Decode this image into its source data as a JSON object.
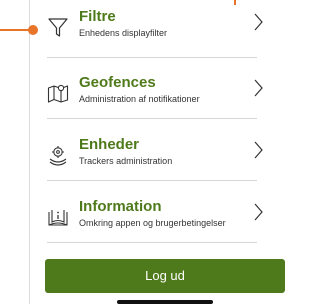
{
  "menu": {
    "items": [
      {
        "id": "filtre",
        "icon": "filter-icon",
        "title": "Filtre",
        "subtitle": "Enhedens displayfilter"
      },
      {
        "id": "geofences",
        "icon": "map-icon",
        "title": "Geofences",
        "subtitle": "Administration af notifikationer"
      },
      {
        "id": "enheder",
        "icon": "tracker-device-icon",
        "title": "Enheder",
        "subtitle": "Trackers administration"
      },
      {
        "id": "information",
        "icon": "info-book-icon",
        "title": "Information",
        "subtitle": "Omkring appen og brugerbetingelser"
      }
    ]
  },
  "logout": {
    "label": "Log ud"
  },
  "colors": {
    "accent": "#e8742a",
    "brand": "#4f7a1b",
    "text": "#333333",
    "divider": "#d6d6d6"
  }
}
